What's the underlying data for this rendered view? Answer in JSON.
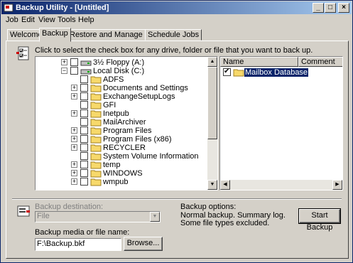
{
  "window": {
    "title": "Backup Utility - [Untitled]",
    "title_color": "#0a246a"
  },
  "menu": [
    "Job",
    "Edit",
    "View",
    "Tools",
    "Help"
  ],
  "tabs": [
    {
      "label": "Welcome",
      "active": false
    },
    {
      "label": "Backup",
      "active": true
    },
    {
      "label": "Restore and Manage Media",
      "active": false
    },
    {
      "label": "Schedule Jobs",
      "active": false
    }
  ],
  "backup_tab": {
    "instruction": "Click to select the check box for any drive, folder or file that you want to back up.",
    "tree": [
      {
        "label": "3½ Floppy (A:)",
        "icon": "floppy-drive-icon",
        "expander": "+",
        "checked": false
      },
      {
        "label": "Local Disk (C:)",
        "icon": "disk-drive-icon",
        "expander": "−",
        "checked": false
      },
      {
        "label": "ADFS",
        "icon": "folder-icon",
        "expander": "",
        "checked": false
      },
      {
        "label": "Documents and Settings",
        "icon": "folder-icon",
        "expander": "+",
        "checked": false
      },
      {
        "label": "ExchangeSetupLogs",
        "icon": "folder-icon",
        "expander": "+",
        "checked": false
      },
      {
        "label": "GFI",
        "icon": "folder-icon",
        "expander": "",
        "checked": false
      },
      {
        "label": "Inetpub",
        "icon": "folder-icon",
        "expander": "+",
        "checked": false
      },
      {
        "label": "MailArchiver",
        "icon": "folder-icon",
        "expander": "",
        "checked": false
      },
      {
        "label": "Program Files",
        "icon": "folder-icon",
        "expander": "+",
        "checked": false
      },
      {
        "label": "Program Files (x86)",
        "icon": "folder-icon",
        "expander": "+",
        "checked": false
      },
      {
        "label": "RECYCLER",
        "icon": "folder-icon",
        "expander": "+",
        "checked": false
      },
      {
        "label": "System Volume Information",
        "icon": "folder-icon",
        "expander": "",
        "checked": false
      },
      {
        "label": "temp",
        "icon": "folder-icon",
        "expander": "+",
        "checked": false
      },
      {
        "label": "WINDOWS",
        "icon": "folder-icon",
        "expander": "+",
        "checked": false
      },
      {
        "label": "wmpub",
        "icon": "folder-icon",
        "expander": "+",
        "checked": false
      }
    ],
    "list_columns": [
      "Name",
      "Comment"
    ],
    "list_items": [
      {
        "name": "Mailbox Database",
        "comment": "",
        "checked": true,
        "selected": true
      }
    ],
    "destination_label": "Backup destination:",
    "destination_value": "File",
    "media_label": "Backup media or file name:",
    "media_value": "F:\\Backup.bkf",
    "browse_label": "Browse...",
    "options_label": "Backup options:",
    "options_line1": "Normal backup.  Summary log.",
    "options_line2": "Some file types excluded.",
    "start_label": "Start Backup"
  }
}
